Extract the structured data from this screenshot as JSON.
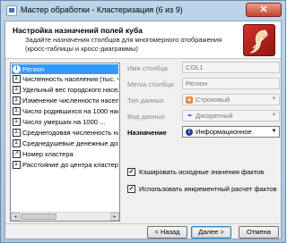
{
  "window": {
    "title": "Мастер обработки - Кластеризация (6 из 9)",
    "close_glyph": "✕"
  },
  "header": {
    "title": "Настройка назначений полей куба",
    "description": "Задайте назначения столбцов для многомерного отображения (кросс-таблицы и кросс-диаграммы)"
  },
  "fields_list": {
    "items": [
      {
        "label": "Регион",
        "icon": "info-icon",
        "glyph": "i",
        "selected": true
      },
      {
        "label": "Численность населения (тыс. ч",
        "icon": "measure-icon",
        "glyph": "Σ",
        "selected": false
      },
      {
        "label": "Удельный вес городского насел",
        "icon": "measure-icon",
        "glyph": "Σ",
        "selected": false
      },
      {
        "label": "Изменение численности населен",
        "icon": "measure-icon",
        "glyph": "Σ",
        "selected": false
      },
      {
        "label": "Число родившихся на 1000 нас",
        "icon": "measure-icon",
        "glyph": "Σ",
        "selected": false
      },
      {
        "label": "Число умерших на 1000 ...",
        "icon": "measure-icon",
        "glyph": "Σ",
        "selected": false
      },
      {
        "label": "Среднегодовая численность на",
        "icon": "measure-icon",
        "glyph": "Σ",
        "selected": false
      },
      {
        "label": "Среднедушевые денежные дох",
        "icon": "measure-icon",
        "glyph": "Σ",
        "selected": false
      },
      {
        "label": "Номер кластера",
        "icon": "dimension-icon",
        "glyph": "↗",
        "selected": false
      },
      {
        "label": "Расстояние до центра кластера",
        "icon": "measure-icon",
        "glyph": "Σ",
        "selected": false
      }
    ],
    "scroll_left": "◂",
    "scroll_right": "▸"
  },
  "properties": {
    "column_name_label": "Имя столбца",
    "column_name_value": "COL1",
    "column_caption_label": "Метка столбца",
    "column_caption_value": "Регион",
    "data_type_label": "Тип данных",
    "data_type_value": "Строковый",
    "data_type_icon_glyph": "a",
    "data_kind_label": "Вид данных",
    "data_kind_value": "Дискретный",
    "data_kind_icon_glyph": "•••",
    "usage_label": "Назначение",
    "usage_value": "Информационное",
    "usage_icon_glyph": "i",
    "dropdown_glyph": "▼"
  },
  "options": {
    "cache_label": "Кэшировать исходные значения фактов",
    "cache_checked": true,
    "incremental_label": "Использовать инкрементный расчет фактов",
    "incremental_checked": true,
    "check_glyph": "✓"
  },
  "buttons": {
    "back": "< Назад",
    "next": "Далее >",
    "cancel": "Отмена"
  }
}
